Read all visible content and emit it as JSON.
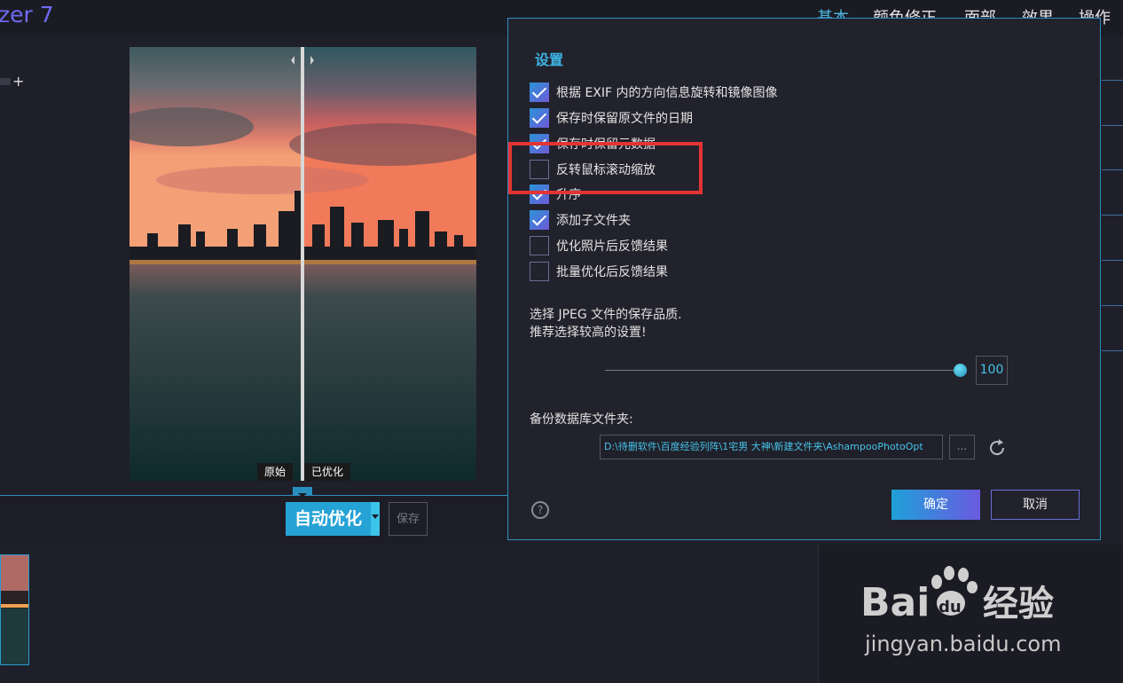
{
  "app": {
    "title_fragment": "zer 7"
  },
  "top_tabs": [
    {
      "label": "基本",
      "active": true
    },
    {
      "label": "颜色修正",
      "active": false
    },
    {
      "label": "面部",
      "active": false
    },
    {
      "label": "效果",
      "active": false
    },
    {
      "label": "操作",
      "active": false
    }
  ],
  "left_panel": {
    "plus": "+"
  },
  "preview": {
    "original_label": "原始",
    "optimized_label": "已优化"
  },
  "action_bar": {
    "auto_optimize": "自动优化",
    "save": "保存"
  },
  "dialog": {
    "title": "设置",
    "options": [
      {
        "label": "根据 EXIF 内的方向信息旋转和镜像图像",
        "checked": true
      },
      {
        "label": "保存时保留原文件的日期",
        "checked": true
      },
      {
        "label": "保存时保留元数据",
        "checked": true
      },
      {
        "label": "反转鼠标滚动缩放",
        "checked": false
      },
      {
        "label": "升序",
        "checked": true
      },
      {
        "label": "添加子文件夹",
        "checked": true
      },
      {
        "label": "优化照片后反馈结果",
        "checked": false
      },
      {
        "label": "批量优化后反馈结果",
        "checked": false
      }
    ],
    "jpeg_line1": "选择 JPEG 文件的保存品质.",
    "jpeg_line2": "推荐选择较高的设置!",
    "quality_value": "100",
    "quality_fraction": 1.0,
    "backup_label": "备份数据库文件夹:",
    "backup_path": "D:\\待删软件\\百度经验列阵\\1宅男 大神\\新建文件夹\\AshampooPhotoOpt",
    "browse": "...",
    "help": "?",
    "ok": "确定",
    "cancel": "取消"
  },
  "watermark": {
    "brand": "Bai du 经验",
    "url": "jingyan.baidu.com"
  },
  "colors": {
    "accent": "#2a8fbf",
    "highlight_red": "#e33434",
    "title_blue": "#3fb6e6"
  },
  "icons": [
    "plus-icon",
    "chevron-left-icon",
    "chevron-right-icon",
    "chevron-down-icon",
    "checkmark-icon",
    "reset-icon",
    "help-icon",
    "paw-icon"
  ]
}
